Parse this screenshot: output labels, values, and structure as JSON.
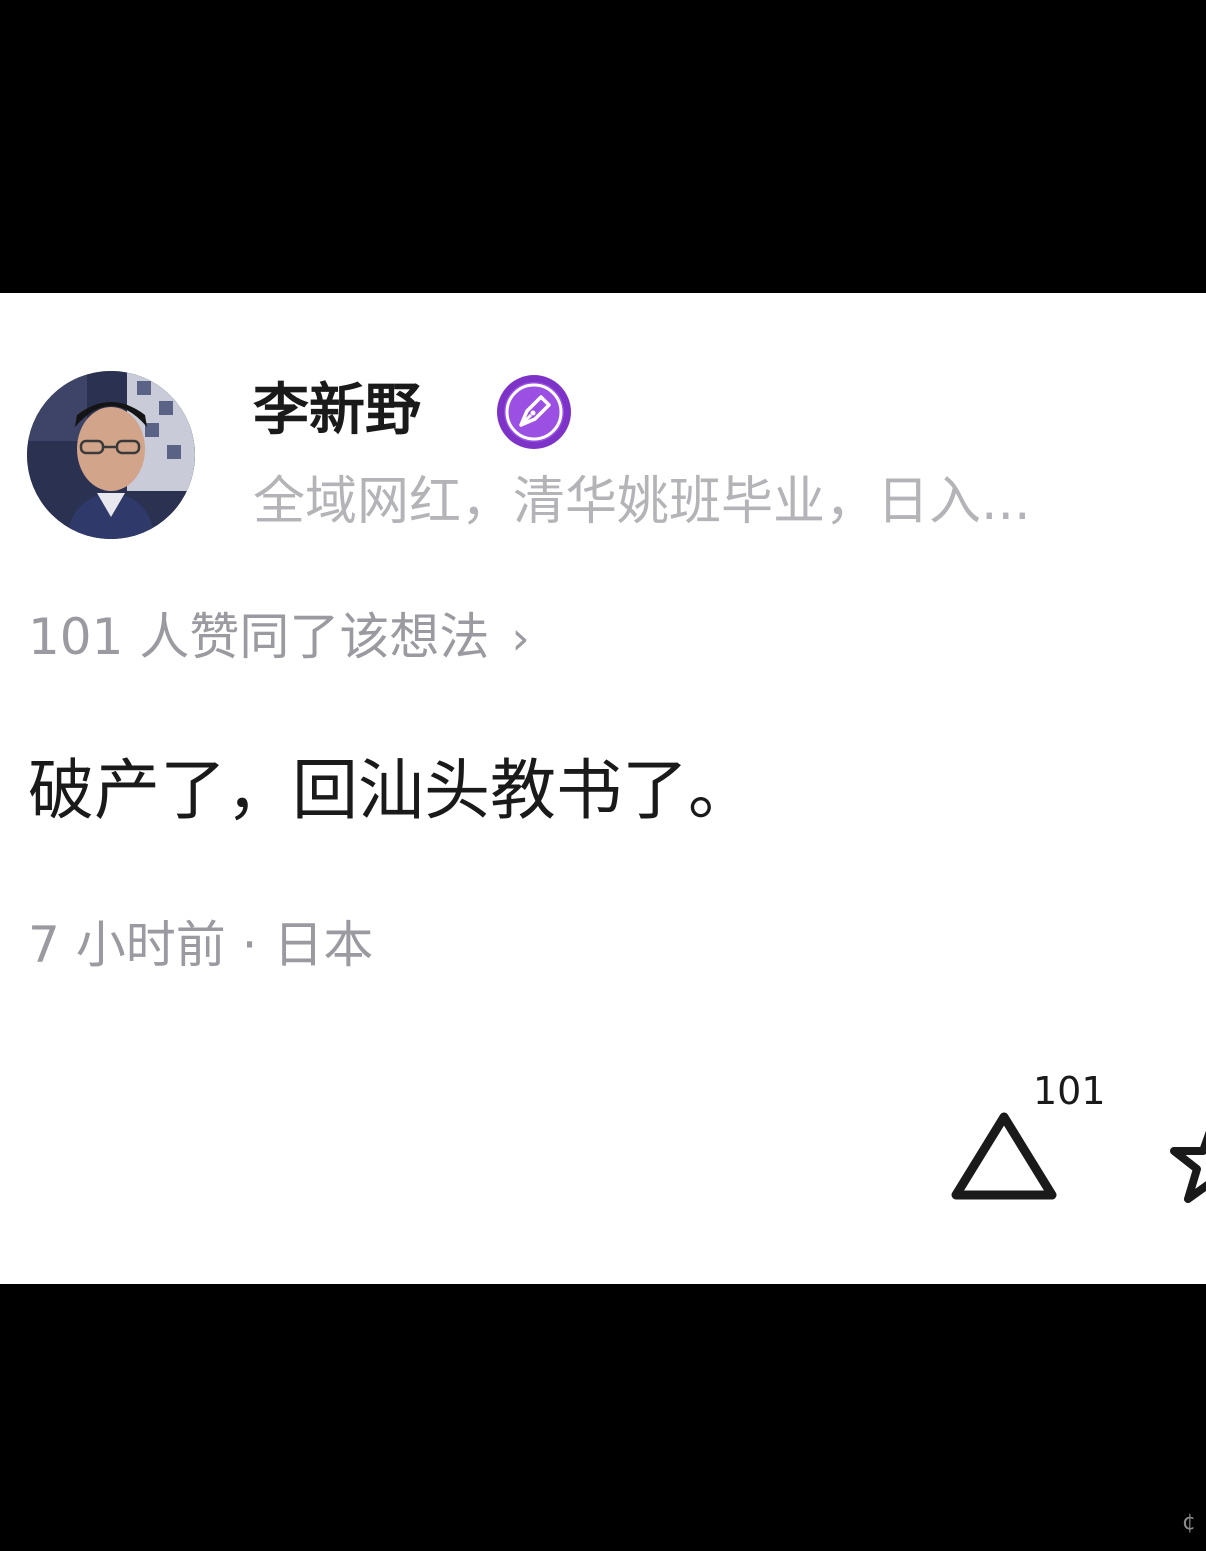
{
  "author": {
    "name": "李新野",
    "badge_icon": "pen-nib-icon",
    "badge_color": "#8e3fd6",
    "bio": "全域网红，清华姚班毕业，日入..."
  },
  "upvoters_line": "101 人赞同了该想法",
  "upvoters_chevron": "›",
  "post": {
    "content": "破产了，回汕头教书了。"
  },
  "meta": "7 小时前 · 日本",
  "actions": {
    "upvote_count": "101",
    "upvote_icon": "upvote-triangle-icon",
    "favorite_icon": "star-icon"
  },
  "colors": {
    "background_outer": "#000000",
    "card": "#ffffff",
    "text_primary": "#1a1a1a",
    "text_secondary": "#9a9aa0",
    "bio_text": "#b4b4b8"
  }
}
